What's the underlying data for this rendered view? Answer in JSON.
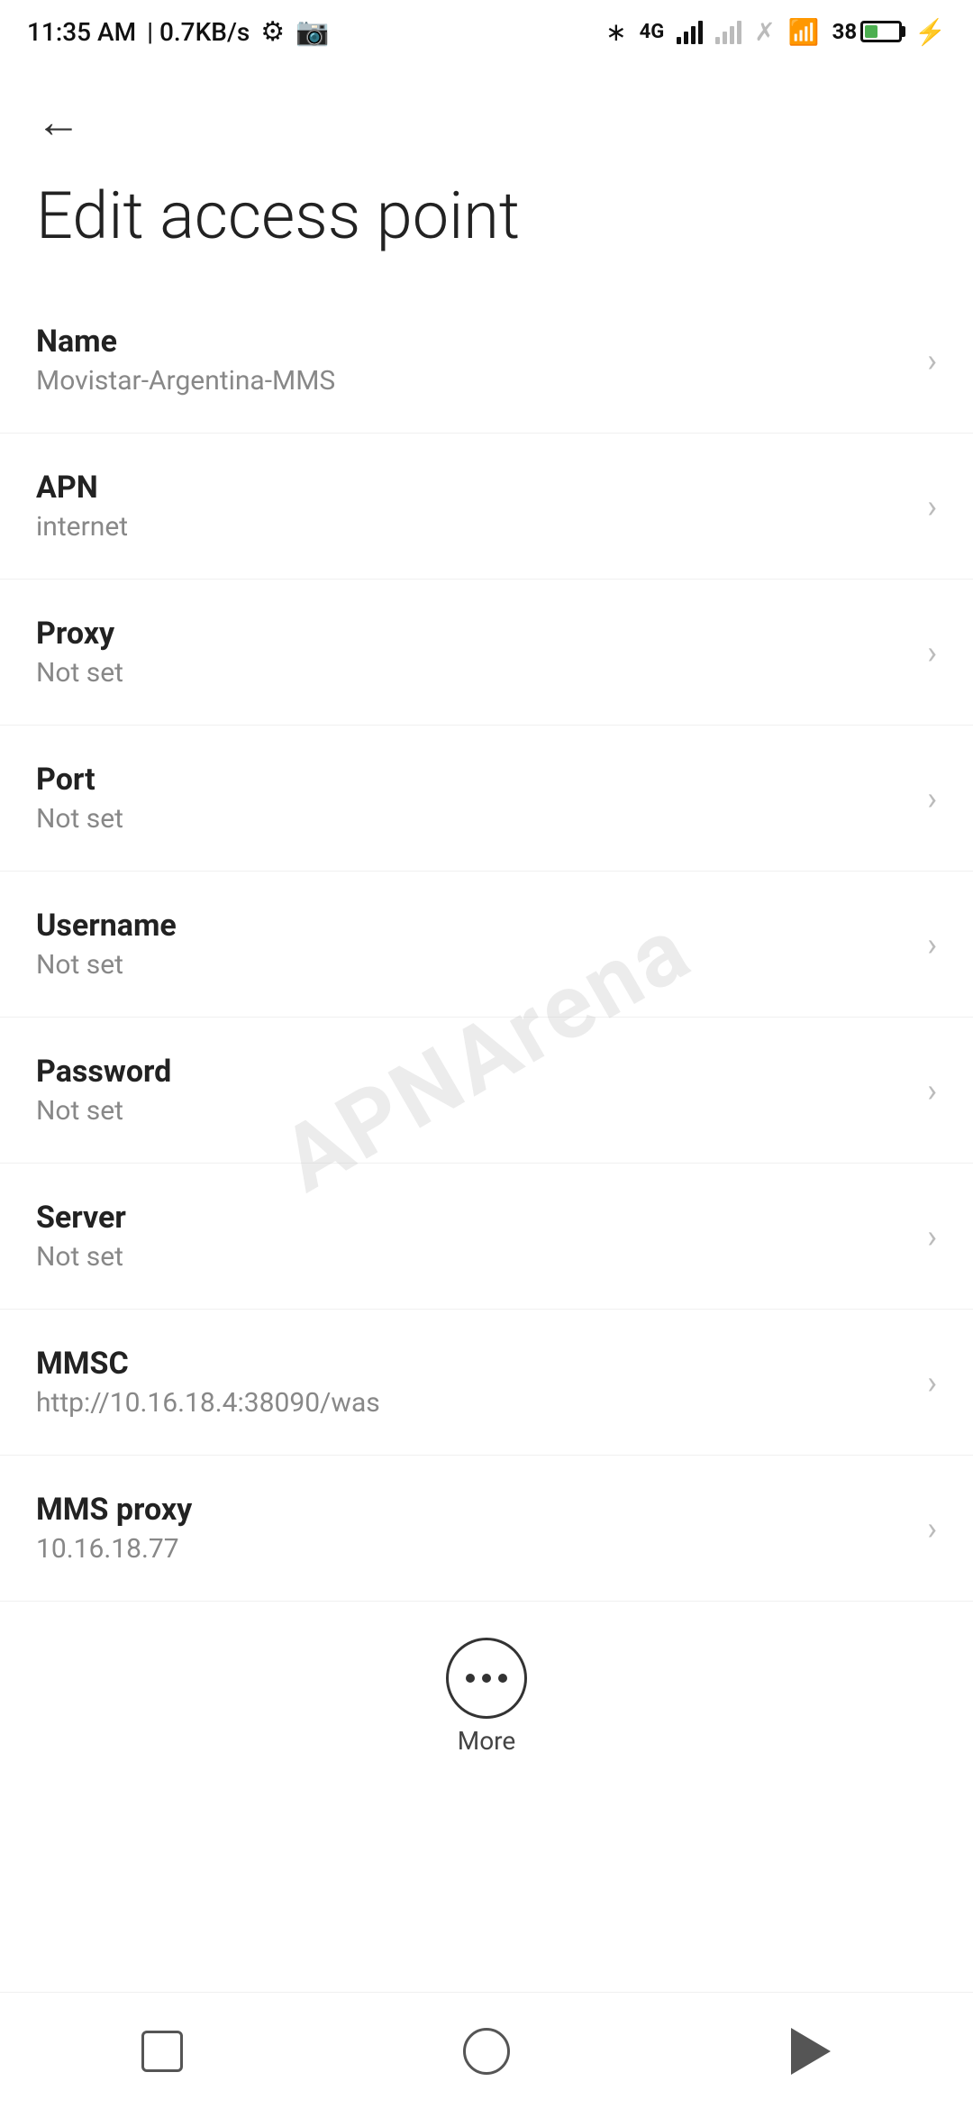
{
  "statusBar": {
    "time": "11:35 AM",
    "speed": "0.7KB/s",
    "battery_pct": "38"
  },
  "header": {
    "back_label": "←",
    "page_title": "Edit access point"
  },
  "settings": {
    "items": [
      {
        "label": "Name",
        "value": "Movistar-Argentina-MMS"
      },
      {
        "label": "APN",
        "value": "internet"
      },
      {
        "label": "Proxy",
        "value": "Not set"
      },
      {
        "label": "Port",
        "value": "Not set"
      },
      {
        "label": "Username",
        "value": "Not set"
      },
      {
        "label": "Password",
        "value": "Not set"
      },
      {
        "label": "Server",
        "value": "Not set"
      },
      {
        "label": "MMSC",
        "value": "http://10.16.18.4:38090/was"
      },
      {
        "label": "MMS proxy",
        "value": "10.16.18.77"
      }
    ]
  },
  "more_button": {
    "label": "More"
  },
  "watermark": {
    "text": "APNArena"
  }
}
